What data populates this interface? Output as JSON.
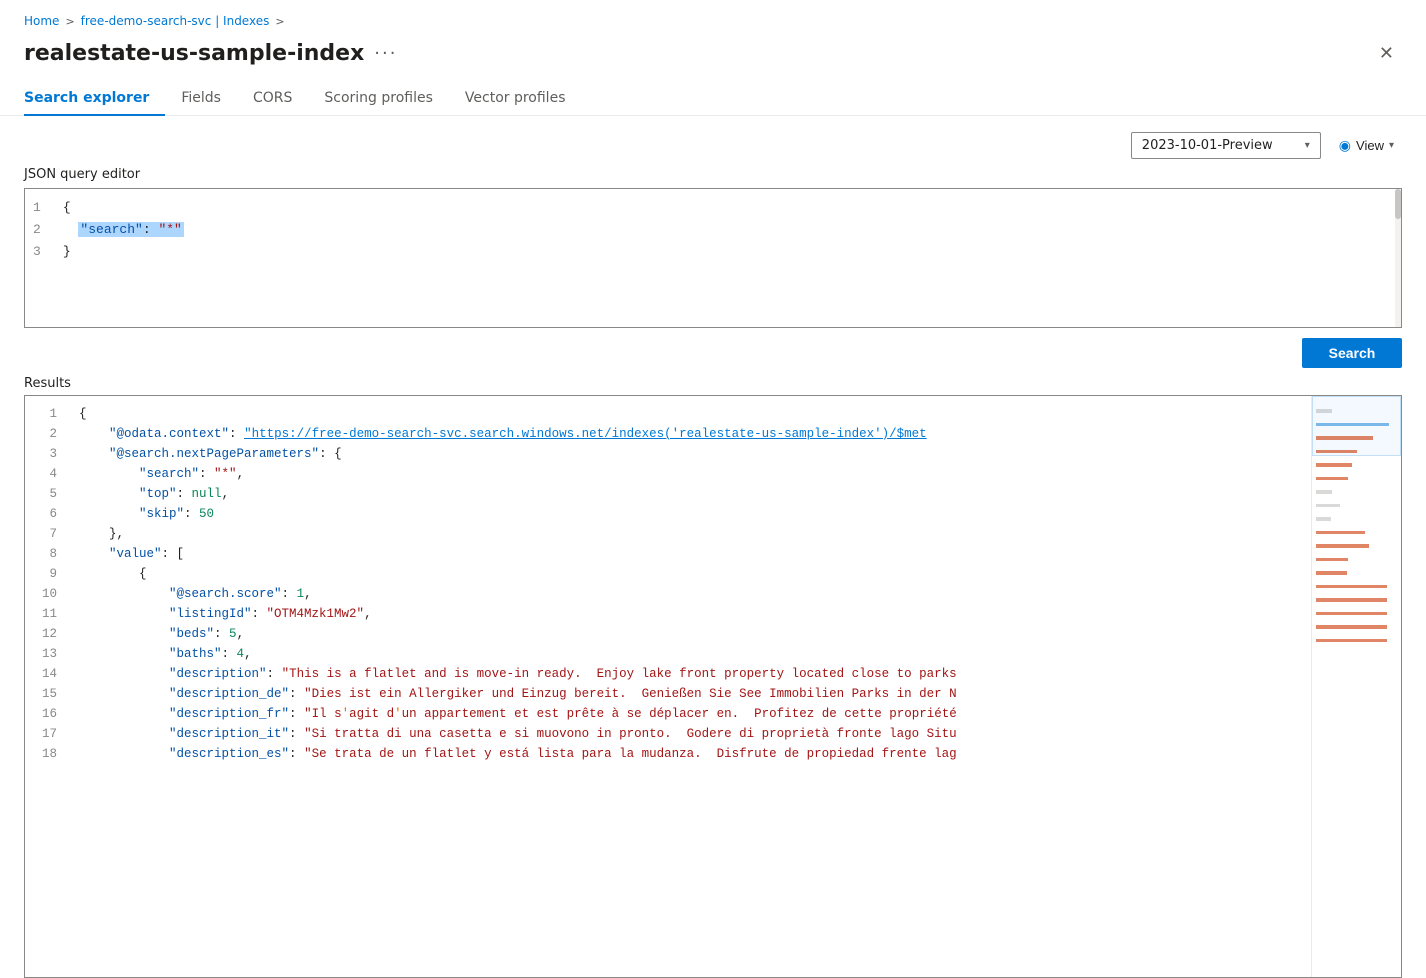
{
  "breadcrumb": {
    "home": "Home",
    "sep1": ">",
    "service": "free-demo-search-svc | Indexes",
    "sep2": ">",
    "current": ""
  },
  "header": {
    "title": "realestate-us-sample-index",
    "ellipsis": "···",
    "close_label": "✕"
  },
  "tabs": [
    {
      "id": "search-explorer",
      "label": "Search explorer",
      "active": true
    },
    {
      "id": "fields",
      "label": "Fields",
      "active": false
    },
    {
      "id": "cors",
      "label": "CORS",
      "active": false
    },
    {
      "id": "scoring-profiles",
      "label": "Scoring profiles",
      "active": false
    },
    {
      "id": "vector-profiles",
      "label": "Vector profiles",
      "active": false
    }
  ],
  "toolbar": {
    "version_label": "2023-10-01-Preview",
    "view_label": "View"
  },
  "editor": {
    "label": "JSON query editor",
    "line1": "{",
    "line2_key": "\"search\"",
    "line2_colon": ": ",
    "line2_value": "\"*\"",
    "line3": "}"
  },
  "search_button": "Search",
  "results": {
    "label": "Results",
    "lines": [
      {
        "num": 1,
        "content": "{"
      },
      {
        "num": 2,
        "content": "    \"@odata.context\": \"https://free-demo-search-svc.search.windows.net/indexes('realestate-us-sample-index')/$met"
      },
      {
        "num": 3,
        "content": "    \"@search.nextPageParameters\": {"
      },
      {
        "num": 4,
        "content": "        \"search\": \"*\","
      },
      {
        "num": 5,
        "content": "        \"top\": null,"
      },
      {
        "num": 6,
        "content": "        \"skip\": 50"
      },
      {
        "num": 7,
        "content": "    },"
      },
      {
        "num": 8,
        "content": "    \"value\": ["
      },
      {
        "num": 9,
        "content": "        {"
      },
      {
        "num": 10,
        "content": "            \"@search.score\": 1,"
      },
      {
        "num": 11,
        "content": "            \"listingId\": \"OTM4Mzk1Mw2\","
      },
      {
        "num": 12,
        "content": "            \"beds\": 5,"
      },
      {
        "num": 13,
        "content": "            \"baths\": 4,"
      },
      {
        "num": 14,
        "content": "            \"description\": \"This is a flatlet and is move-in ready.  Enjoy lake front property located close to parks"
      },
      {
        "num": 15,
        "content": "            \"description_de\": \"Dies ist ein Allergiker und Einzug bereit.  Genießen Sie See Immobilien Parks in der N"
      },
      {
        "num": 16,
        "content": "            \"description_fr\": \"Il s'agit d'un appartement et est prête à se déplacer en.  Profitez de cette propriété"
      },
      {
        "num": 17,
        "content": "            \"description_it\": \"Si tratta di una casetta e si muovono in pronto.  Godere di proprietà fronte lago Situ"
      },
      {
        "num": 18,
        "content": "            \"description_es\": \"Se trata de un flatlet y está lista para la mudanza.  Disfrute de propiedad frente lag"
      }
    ]
  }
}
